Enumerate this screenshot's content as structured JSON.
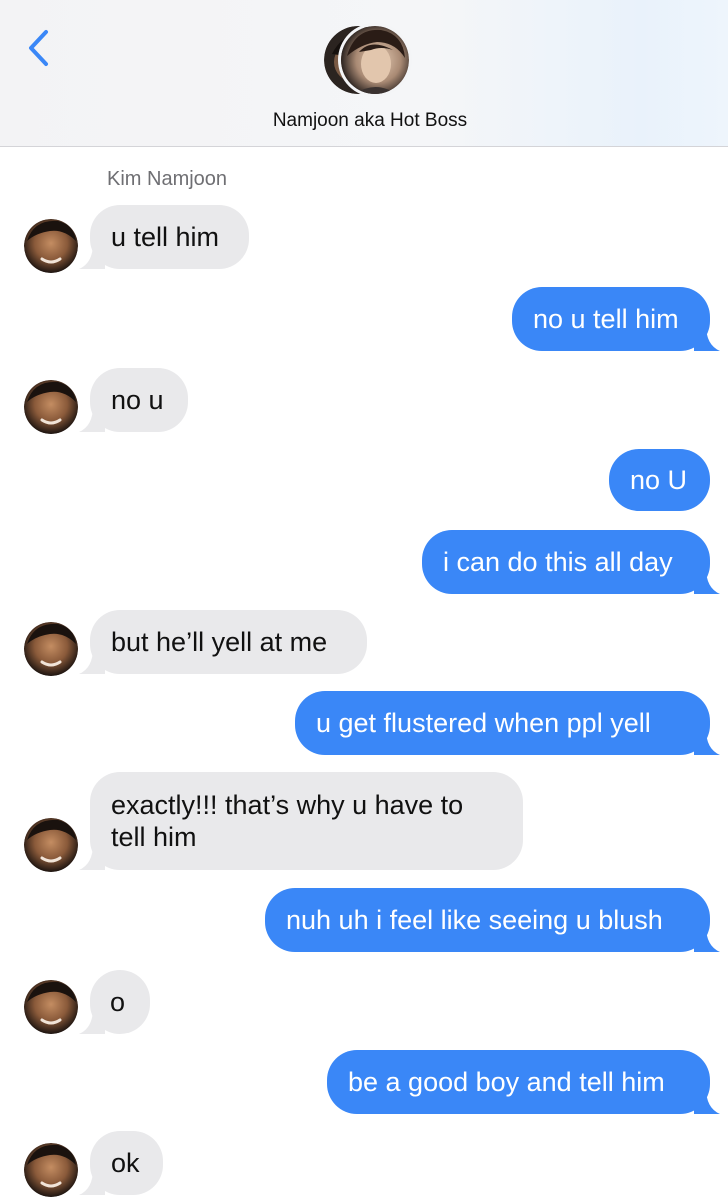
{
  "header": {
    "back_icon": "chevron-left-icon",
    "contact_name": "Namjoon aka Hot Boss",
    "accent": "#3a87f7"
  },
  "thread": {
    "sender_label": "Kim Namjoon",
    "incoming_color": "#e9e9eb",
    "outgoing_color": "#3a87f7",
    "messages": [
      {
        "side": "in",
        "text": "u tell him"
      },
      {
        "side": "out",
        "text": "no u tell him"
      },
      {
        "side": "in",
        "text": "no u"
      },
      {
        "side": "out",
        "text": "no U"
      },
      {
        "side": "out",
        "text": "i can do this all day"
      },
      {
        "side": "in",
        "text": "but he’ll yell at me"
      },
      {
        "side": "out",
        "text": "u get flustered when ppl yell"
      },
      {
        "side": "in",
        "text": "exactly!!! that’s why u have to\ntell him"
      },
      {
        "side": "out",
        "text": "nuh uh i feel like seeing u blush"
      },
      {
        "side": "in",
        "text": "o"
      },
      {
        "side": "out",
        "text": "be a good boy and tell him"
      },
      {
        "side": "in",
        "text": "ok"
      }
    ]
  }
}
